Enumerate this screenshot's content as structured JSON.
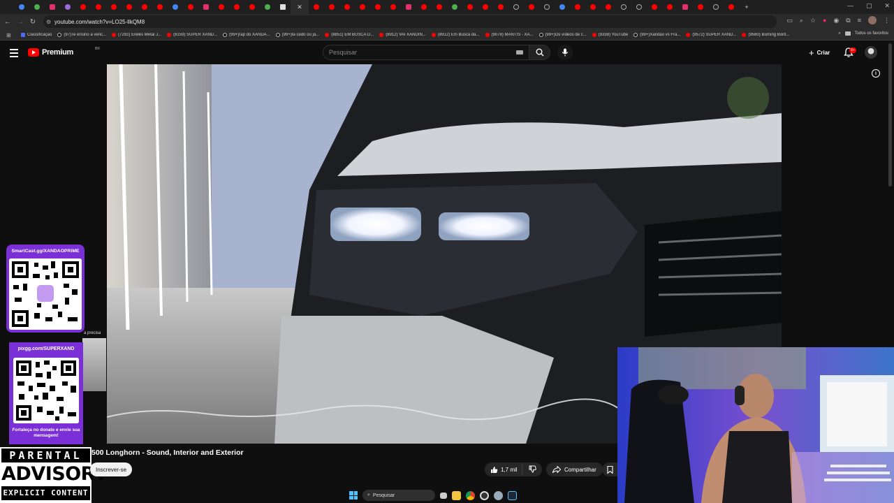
{
  "browser": {
    "url": "youtube.com/watch?v=LO25-llkQM8",
    "bookmarks": [
      {
        "label": "Classificação",
        "icon": "class"
      },
      {
        "label": "(97)Te ensino a venc...",
        "icon": "tiktok"
      },
      {
        "label": "(7292) Ereles Metal J...",
        "icon": "youtube"
      },
      {
        "label": "(8159) SUPER XAND...",
        "icon": "youtube"
      },
      {
        "label": "(99+)rap do XANDA...",
        "icon": "tiktok"
      },
      {
        "label": "(99+)tá cedo ou já...",
        "icon": "tiktok"
      },
      {
        "label": "(8851) EM BUSCA D...",
        "icon": "youtube"
      },
      {
        "label": "(8912) VAI XANDIN...",
        "icon": "youtube"
      },
      {
        "label": "(8912) Em Busca da...",
        "icon": "youtube"
      },
      {
        "label": "(9078) MANTIS - XA...",
        "icon": "youtube"
      },
      {
        "label": "(99+)Os vídeos de c...",
        "icon": "tiktok"
      },
      {
        "label": "(9338) YouTube",
        "icon": "youtube"
      },
      {
        "label": "(99+)Xandão vs Fra...",
        "icon": "tiktok"
      },
      {
        "label": "(9572) SUPER XAND...",
        "icon": "youtube"
      },
      {
        "label": "(9580) Burning Bord...",
        "icon": "youtube"
      }
    ],
    "all_bookmarks_label": "Todos os favoritos"
  },
  "youtube": {
    "logo_text": "Premium",
    "logo_region": "BR",
    "search_placeholder": "Pesquisar",
    "create_label": "Criar",
    "notification_count": "9+",
    "video_title": "500 Longhorn - Sound, Interior and Exterior",
    "subscribe_label": "Inscrever-se",
    "like_count": "1,7 mil",
    "share_label": "Compartilhar"
  },
  "overlay": {
    "qr_top_title": "SmartCast.gg/XANDAOPRIME",
    "qr_bottom_title": "pixgg.com/SUPERXAND",
    "qr_bottom_message": "Fortaleça no donate e envie sua mensagem!",
    "side_text": "a precisa",
    "advisory_line1": "PARENTAL",
    "advisory_line2": "ADVISORY",
    "advisory_line3": "EXPLICIT CONTENT"
  },
  "taskbar": {
    "search_placeholder": "Pesquisar"
  },
  "colors": {
    "accent": "#ff0000",
    "overlay_purple": "#7b2fd6",
    "background": "#0f0f0f"
  }
}
